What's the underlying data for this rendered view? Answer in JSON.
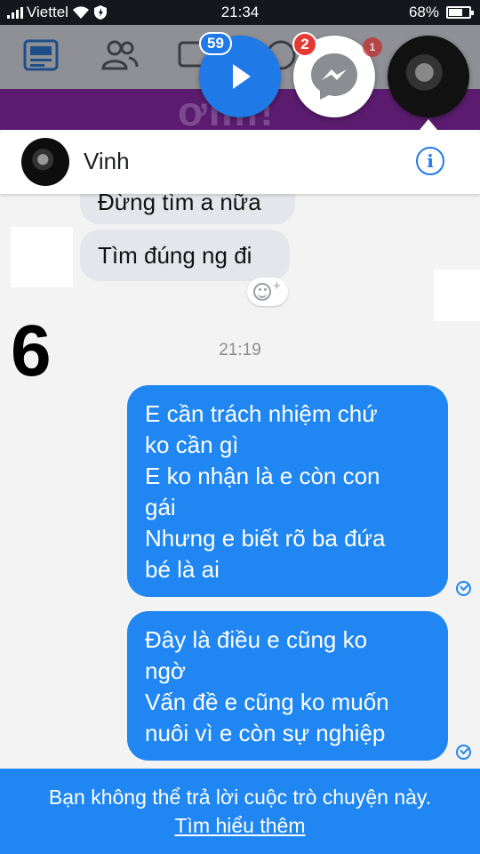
{
  "status_bar": {
    "carrier": "Viettel",
    "time": "21:34",
    "battery": "68%",
    "battery_level": 0.68
  },
  "chat_heads": {
    "video_count": "59",
    "messenger_count": "2",
    "notification_count": "1"
  },
  "background_banner": "ơmi!",
  "conversation": {
    "contact_name": "Vinh",
    "incoming": [
      {
        "text": "Đừng tìm a nữa"
      },
      {
        "text": "Tìm đúng ng đi"
      }
    ],
    "overlay_number": "6",
    "timestamp": "21:19",
    "outgoing": [
      {
        "lines": [
          "E cần trách nhiệm chứ",
          "ko cần gì",
          "E ko nhận là e còn con",
          "gái",
          "Nhưng e biết rõ ba đứa",
          "bé là ai"
        ]
      },
      {
        "lines": [
          "Đây là điều e cũng ko",
          "ngờ",
          "Vấn đề e cũng ko muốn",
          "nuôi vì e còn sự nghiệp"
        ]
      }
    ]
  },
  "footer": {
    "notice": "Bạn không thể trả lời cuộc trò chuyện này.",
    "link": "Tìm hiểu thêm"
  },
  "colors": {
    "messenger_blue": "#1f86f2",
    "status_bar": "#14171c",
    "incoming_bubble": "#e4e6eb"
  },
  "icons": [
    "wifi-icon",
    "shield-icon",
    "news-feed-icon",
    "friends-icon",
    "video-icon",
    "play-icon",
    "messenger-icon",
    "info-icon",
    "reaction-icon",
    "seen-check-icon"
  ]
}
